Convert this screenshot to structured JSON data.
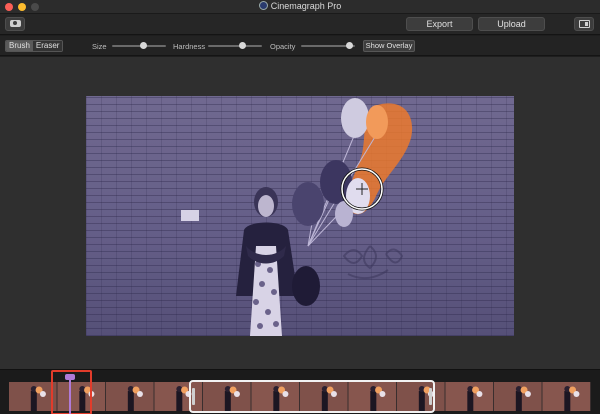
{
  "window": {
    "title": "Cinemagraph Pro"
  },
  "toolbar": {
    "left_icon": "camera-icon",
    "export_label": "Export",
    "upload_label": "Upload",
    "panel_icon": "sidebar-toggle-icon"
  },
  "options": {
    "modes": [
      {
        "label": "Brush",
        "selected": true
      },
      {
        "label": "Eraser",
        "selected": false
      }
    ],
    "size_label": "Size",
    "size_value": 0.6,
    "hardness_label": "Hardness",
    "hardness_value": 0.67,
    "opacity_label": "Opacity",
    "opacity_value": 0.95,
    "overlay_label": "Show Overlay"
  },
  "canvas": {
    "tint_color": "#6d668e",
    "mask_color": "#f07a2a",
    "cursor": "brush-cursor-icon"
  },
  "filmstrip": {
    "frame_count": 12,
    "selection_color": "#f2f2f2",
    "playhead_color": "#b07ad8",
    "highlight_color": "#e23c2b"
  },
  "colors": {
    "close": "#fc5f57",
    "minimize": "#fdbc2e",
    "zoom": "#4a4a4a"
  }
}
